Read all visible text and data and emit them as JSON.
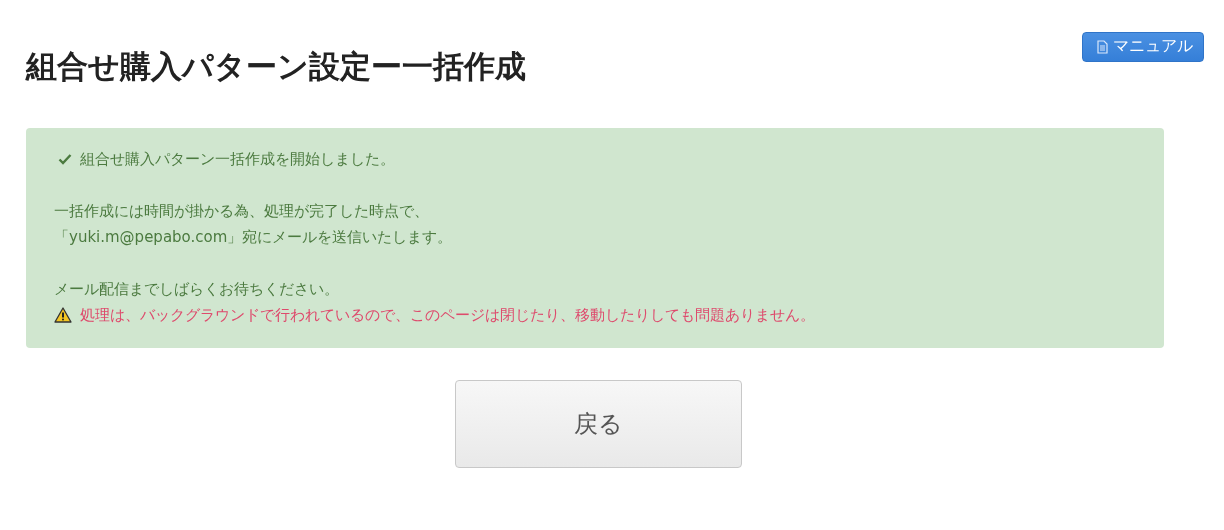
{
  "header": {
    "title": "組合せ購入パターン設定ー一括作成",
    "manual_button": "マニュアル"
  },
  "alert": {
    "messages": [
      {
        "kind": "success",
        "lines": [
          "組合せ購入パターン一括作成を開始しました。"
        ]
      },
      {
        "kind": "text",
        "lines": [
          "一括作成には時間が掛かる為、処理が完了した時点で、",
          "「yuki.m@pepabo.com」宛にメールを送信いたします。"
        ]
      },
      {
        "kind": "text",
        "lines": [
          "メール配信までしばらくお待ちください。"
        ]
      },
      {
        "kind": "warning",
        "lines": [
          "処理は、バックグラウンドで行われているので、このページは閉じたり、移動したりしても問題ありません。"
        ]
      }
    ]
  },
  "buttons": [
    "戻る"
  ]
}
